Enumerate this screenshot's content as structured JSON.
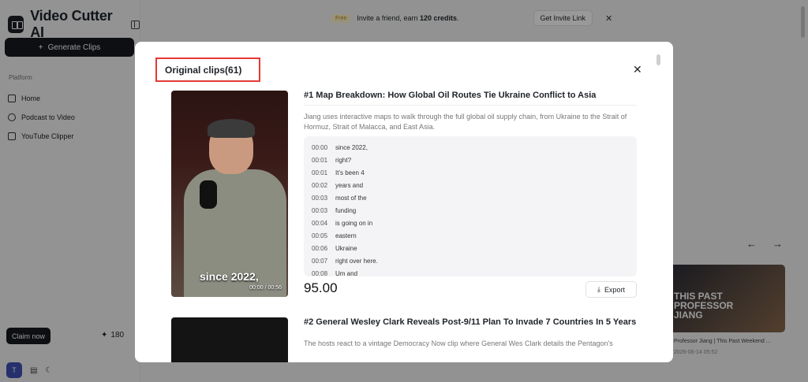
{
  "app": {
    "name": "Video Cutter AI"
  },
  "sidebar": {
    "generate_label": "Generate Clips",
    "section_label": "Platform",
    "items": [
      {
        "label": "Home",
        "icon": "home-icon"
      },
      {
        "label": "Podcast to Video",
        "icon": "podcast-icon"
      },
      {
        "label": "YouTube Clipper",
        "icon": "youtube-icon"
      }
    ],
    "claim_label": "Claim now",
    "credits": "180",
    "avatar_initial": "T"
  },
  "topbar": {
    "badge": "Free",
    "invite_text_before": "Invite a friend, earn ",
    "invite_text_bold": "120 credits",
    "invite_text_after": ".",
    "invite_button": "Get Invite Link"
  },
  "background_card": {
    "thumb_text_line1": "THIS PAST",
    "thumb_text_line2": "PROFESSOR",
    "thumb_text_line3": "JIANG",
    "title": "Professor Jiang | This Past Weekend ...",
    "date": "2026-06-14 05:52"
  },
  "modal": {
    "title": "Original clips(61)",
    "clips": [
      {
        "title": "#1 Map Breakdown: How Global Oil Routes Tie Ukraine Conflict to Asia",
        "description": "Jiang uses interactive maps to walk through the full global oil supply chain, from Ukraine to the Strait of Hormuz, Strait of Malacca, and East Asia.",
        "caption": "since 2022,",
        "time": "00:00 / 00:56",
        "score": "95.00",
        "export_label": "Export",
        "transcript": [
          {
            "t": "00:00",
            "text": "since 2022,"
          },
          {
            "t": "00:01",
            "text": "right?"
          },
          {
            "t": "00:01",
            "text": "It's been 4"
          },
          {
            "t": "00:02",
            "text": "years and"
          },
          {
            "t": "00:03",
            "text": "most of the"
          },
          {
            "t": "00:03",
            "text": "funding"
          },
          {
            "t": "00:04",
            "text": "is going on in"
          },
          {
            "t": "00:05",
            "text": "eastern"
          },
          {
            "t": "00:06",
            "text": "Ukraine"
          },
          {
            "t": "00:07",
            "text": "right over here."
          },
          {
            "t": "00:08",
            "text": "Um and"
          }
        ]
      },
      {
        "title": "#2 General Wesley Clark Reveals Post-9/11 Plan To Invade 7 Countries In 5 Years",
        "description": "The hosts react to a vintage Democracy Now clip where General Wes Clark details the Pentagon's"
      }
    ]
  }
}
